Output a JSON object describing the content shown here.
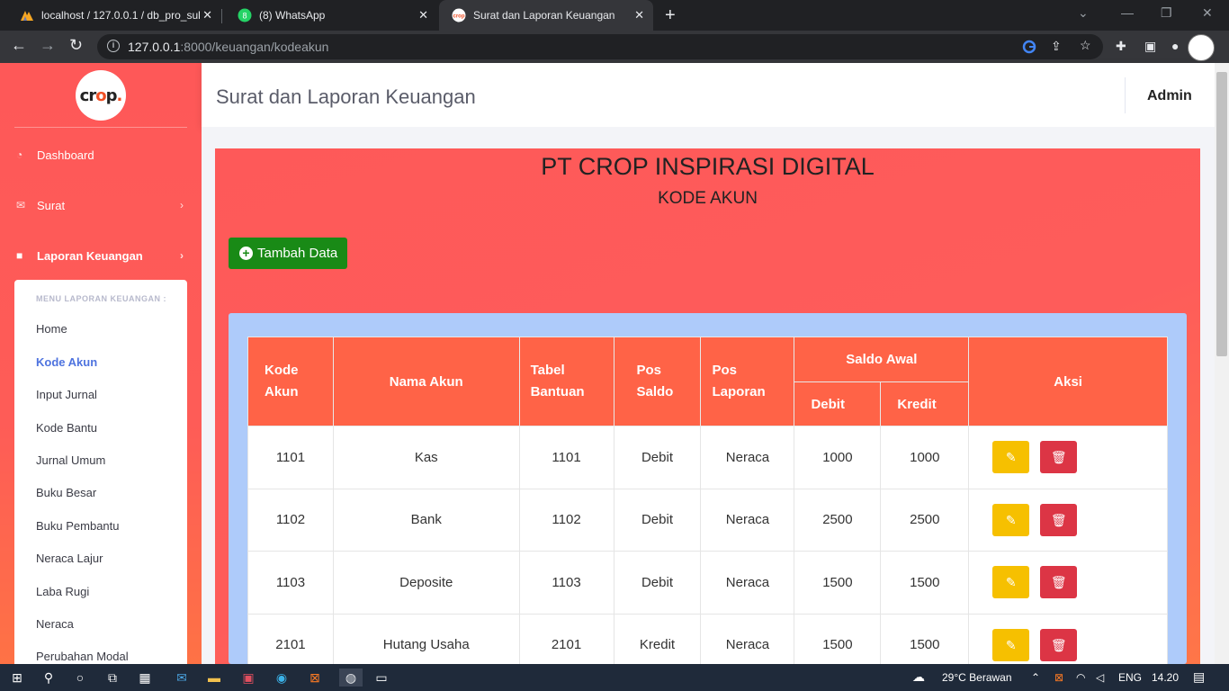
{
  "browser": {
    "tabs": [
      {
        "title": "localhost / 127.0.0.1 / db_pro_sul",
        "active": false
      },
      {
        "title": "(8) WhatsApp",
        "active": false
      },
      {
        "title": "Surat dan Laporan Keuangan",
        "active": true
      }
    ],
    "url_host": "127.0.0.1",
    "url_rest": ":8000/keuangan/kodeakun"
  },
  "sidebar": {
    "logo_text": "crop.",
    "nav": [
      {
        "label": "Dashboard",
        "icon": "tachometer-icon"
      },
      {
        "label": "Surat",
        "icon": "envelope-icon"
      },
      {
        "label": "Laporan Keuangan",
        "icon": "folder-icon"
      }
    ],
    "submenu": {
      "header": "MENU LAPORAN KEUANGAN :",
      "items": [
        "Home",
        "Kode Akun",
        "Input Jurnal",
        "Kode Bantu",
        "Jurnal Umum",
        "Buku Besar",
        "Buku Pembantu",
        "Neraca Lajur",
        "Laba Rugi",
        "Neraca",
        "Perubahan Modal"
      ],
      "active": "Kode Akun"
    }
  },
  "topbar": {
    "title": "Surat dan Laporan Keuangan",
    "user": "Admin"
  },
  "main": {
    "company": "PT CROP INSPIRASI DIGITAL",
    "subtitle": "KODE AKUN",
    "add_button": "Tambah Data",
    "table": {
      "headers": {
        "kode_akun": "Kode Akun",
        "nama_akun": "Nama Akun",
        "tabel_bantuan": "Tabel Bantuan",
        "pos_saldo": "Pos Saldo",
        "pos_laporan": "Pos Laporan",
        "saldo_awal": "Saldo Awal",
        "debit": "Debit",
        "kredit": "Kredit",
        "aksi": "Aksi"
      },
      "rows": [
        {
          "kode": "1101",
          "nama": "Kas",
          "bantuan": "1101",
          "pos_saldo": "Debit",
          "pos_laporan": "Neraca",
          "debit": "1000",
          "kredit": "1000"
        },
        {
          "kode": "1102",
          "nama": "Bank",
          "bantuan": "1102",
          "pos_saldo": "Debit",
          "pos_laporan": "Neraca",
          "debit": "2500",
          "kredit": "2500"
        },
        {
          "kode": "1103",
          "nama": "Deposite",
          "bantuan": "1103",
          "pos_saldo": "Debit",
          "pos_laporan": "Neraca",
          "debit": "1500",
          "kredit": "1500"
        },
        {
          "kode": "2101",
          "nama": "Hutang Usaha",
          "bantuan": "2101",
          "pos_saldo": "Kredit",
          "pos_laporan": "Neraca",
          "debit": "1500",
          "kredit": "1500"
        }
      ]
    }
  },
  "taskbar": {
    "weather": "29°C  Berawan",
    "lang": "ENG",
    "time": "14.20"
  },
  "colors": {
    "sidebar": "#fe5858",
    "table_header": "#ff6347",
    "add_button": "#198a16",
    "edit_button": "#f6c000",
    "delete_button": "#dc3545",
    "active_link": "#4e73df"
  }
}
